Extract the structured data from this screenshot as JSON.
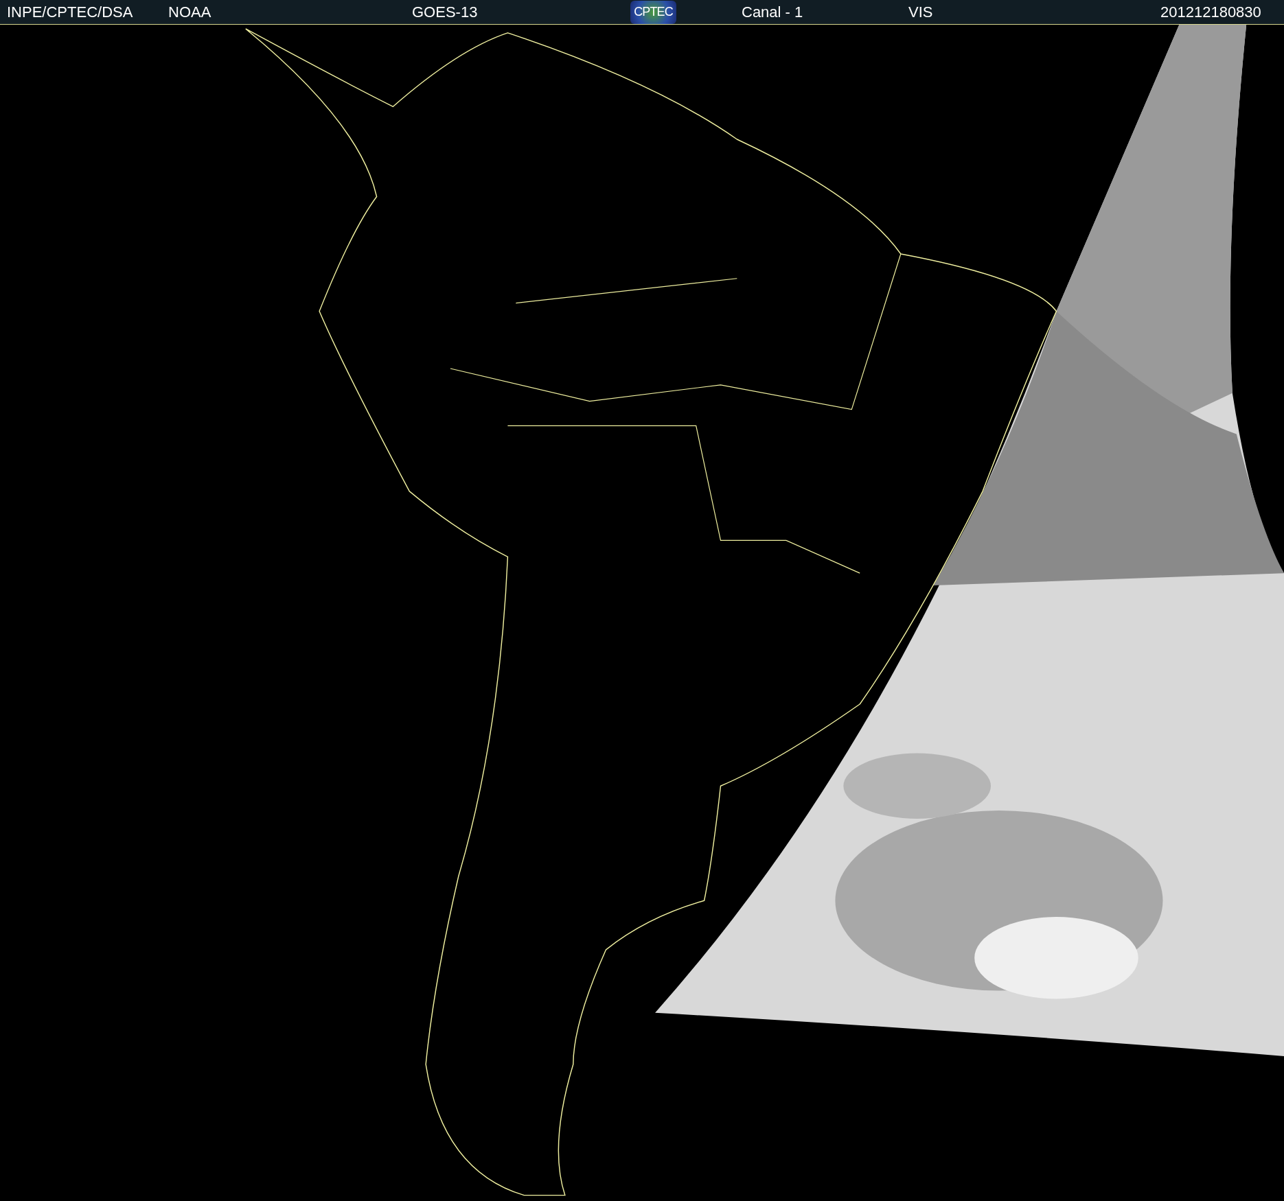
{
  "header": {
    "items": [
      {
        "kind": "text",
        "text": "INPE/CPTEC/DSA"
      },
      {
        "kind": "text",
        "text": "NOAA"
      },
      {
        "kind": "text",
        "text": "GOES-13"
      },
      {
        "kind": "logo",
        "text": "CPTEC"
      },
      {
        "kind": "text",
        "text": "Canal - 1"
      },
      {
        "kind": "text",
        "text": "VIS"
      },
      {
        "kind": "text",
        "text": "201212180830"
      }
    ]
  }
}
